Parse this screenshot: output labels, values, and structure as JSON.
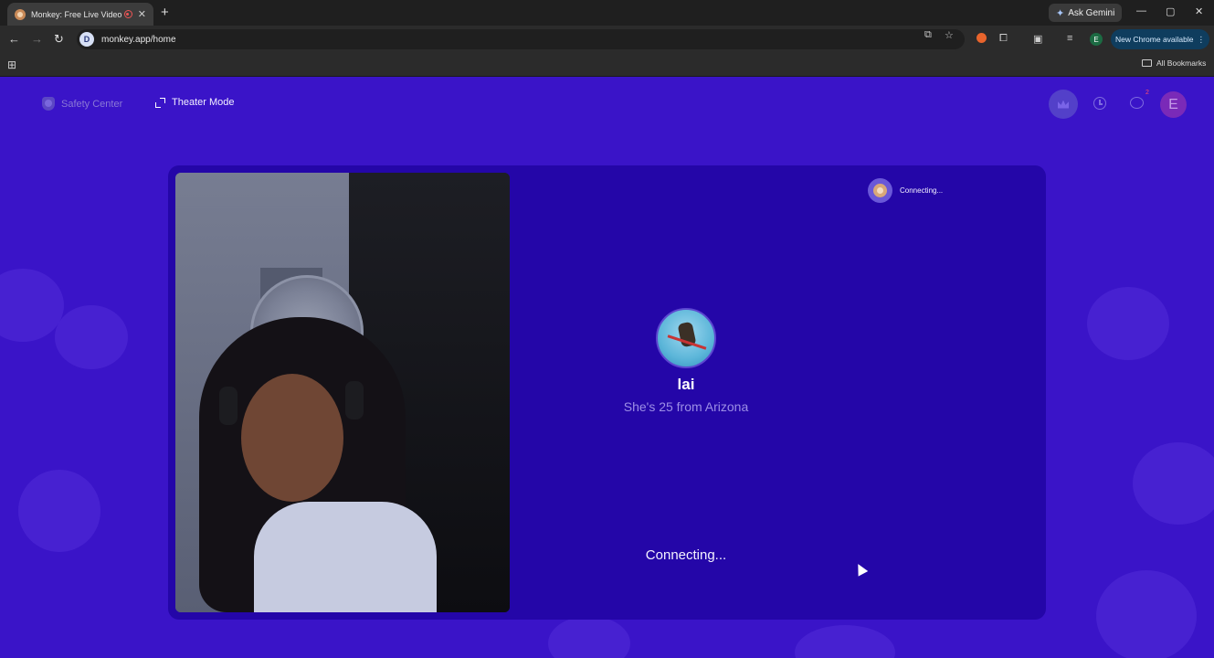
{
  "browser": {
    "tab_title": "Monkey: Free Live Video Ch",
    "tab_close": "✕",
    "new_tab": "+",
    "ask_gemini": "Ask Gemini",
    "window_controls": [
      "—",
      "▢",
      "✕"
    ],
    "url": "monkey.app/home",
    "site_badge": "D",
    "update_label": "New Chrome available",
    "profile_initial": "E",
    "bookmarks_label": "All Bookmarks"
  },
  "header": {
    "safety_label": "Safety Center",
    "theater_label": "Theater Mode",
    "chat_badge": "2",
    "avatar_initial": "E"
  },
  "call": {
    "mini_status": "Connecting...",
    "peer_name": "lai",
    "peer_subtitle": "She's 25 from Arizona",
    "status": "Connecting..."
  },
  "colors": {
    "page_bg": "#3a14c8",
    "stage_bg": "#2406a8",
    "accent": "#7e6bdf",
    "badge": "#ff4d6d"
  }
}
